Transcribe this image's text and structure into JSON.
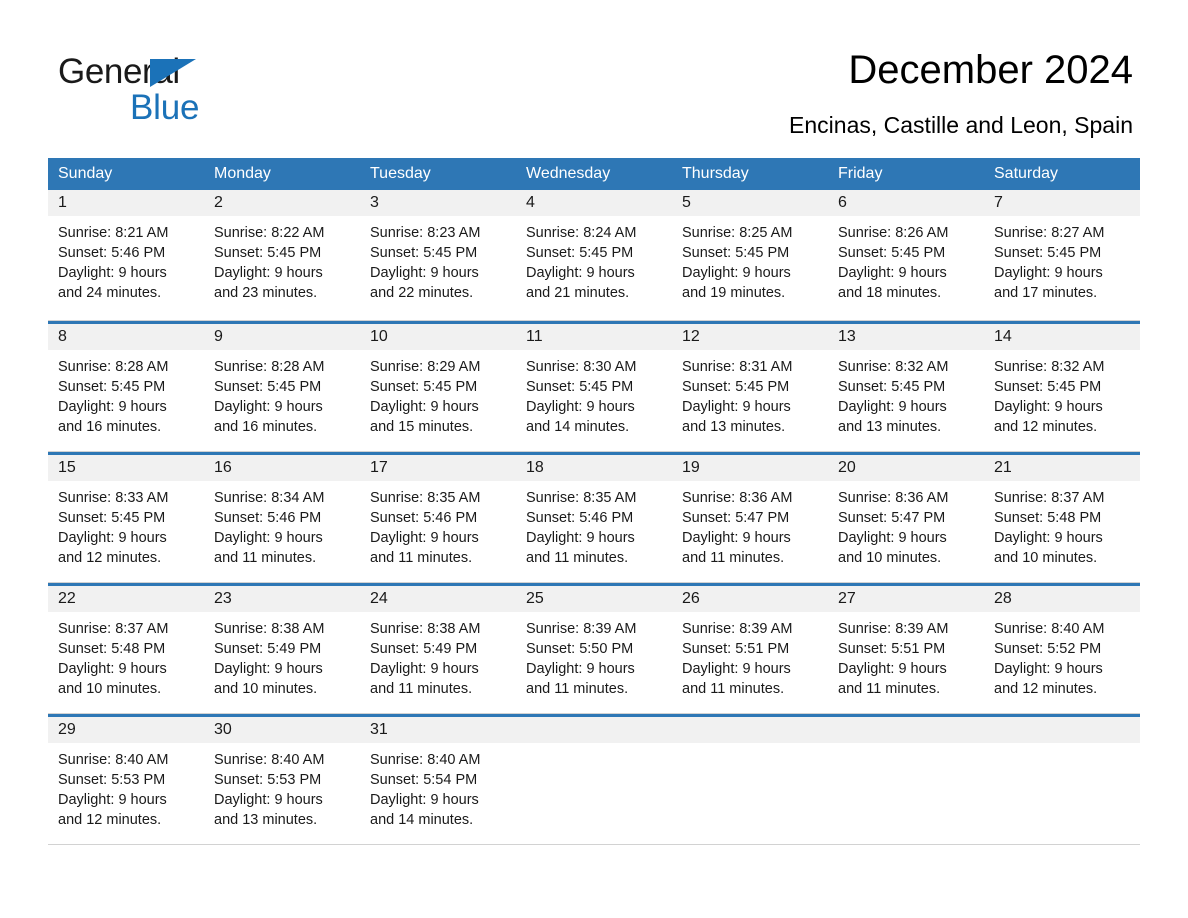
{
  "brand": {
    "name_part1": "General",
    "name_part2": "Blue",
    "accent_color": "#1b72b8"
  },
  "header": {
    "title": "December 2024",
    "subtitle": "Encinas, Castille and Leon, Spain"
  },
  "calendar": {
    "header_bg": "#2e77b5",
    "day_band_bg": "#f1f1f1",
    "weekdays": [
      "Sunday",
      "Monday",
      "Tuesday",
      "Wednesday",
      "Thursday",
      "Friday",
      "Saturday"
    ],
    "weeks": [
      [
        {
          "day": "1",
          "sunrise": "Sunrise: 8:21 AM",
          "sunset": "Sunset: 5:46 PM",
          "daylight_line1": "Daylight: 9 hours",
          "daylight_line2": "and 24 minutes."
        },
        {
          "day": "2",
          "sunrise": "Sunrise: 8:22 AM",
          "sunset": "Sunset: 5:45 PM",
          "daylight_line1": "Daylight: 9 hours",
          "daylight_line2": "and 23 minutes."
        },
        {
          "day": "3",
          "sunrise": "Sunrise: 8:23 AM",
          "sunset": "Sunset: 5:45 PM",
          "daylight_line1": "Daylight: 9 hours",
          "daylight_line2": "and 22 minutes."
        },
        {
          "day": "4",
          "sunrise": "Sunrise: 8:24 AM",
          "sunset": "Sunset: 5:45 PM",
          "daylight_line1": "Daylight: 9 hours",
          "daylight_line2": "and 21 minutes."
        },
        {
          "day": "5",
          "sunrise": "Sunrise: 8:25 AM",
          "sunset": "Sunset: 5:45 PM",
          "daylight_line1": "Daylight: 9 hours",
          "daylight_line2": "and 19 minutes."
        },
        {
          "day": "6",
          "sunrise": "Sunrise: 8:26 AM",
          "sunset": "Sunset: 5:45 PM",
          "daylight_line1": "Daylight: 9 hours",
          "daylight_line2": "and 18 minutes."
        },
        {
          "day": "7",
          "sunrise": "Sunrise: 8:27 AM",
          "sunset": "Sunset: 5:45 PM",
          "daylight_line1": "Daylight: 9 hours",
          "daylight_line2": "and 17 minutes."
        }
      ],
      [
        {
          "day": "8",
          "sunrise": "Sunrise: 8:28 AM",
          "sunset": "Sunset: 5:45 PM",
          "daylight_line1": "Daylight: 9 hours",
          "daylight_line2": "and 16 minutes."
        },
        {
          "day": "9",
          "sunrise": "Sunrise: 8:28 AM",
          "sunset": "Sunset: 5:45 PM",
          "daylight_line1": "Daylight: 9 hours",
          "daylight_line2": "and 16 minutes."
        },
        {
          "day": "10",
          "sunrise": "Sunrise: 8:29 AM",
          "sunset": "Sunset: 5:45 PM",
          "daylight_line1": "Daylight: 9 hours",
          "daylight_line2": "and 15 minutes."
        },
        {
          "day": "11",
          "sunrise": "Sunrise: 8:30 AM",
          "sunset": "Sunset: 5:45 PM",
          "daylight_line1": "Daylight: 9 hours",
          "daylight_line2": "and 14 minutes."
        },
        {
          "day": "12",
          "sunrise": "Sunrise: 8:31 AM",
          "sunset": "Sunset: 5:45 PM",
          "daylight_line1": "Daylight: 9 hours",
          "daylight_line2": "and 13 minutes."
        },
        {
          "day": "13",
          "sunrise": "Sunrise: 8:32 AM",
          "sunset": "Sunset: 5:45 PM",
          "daylight_line1": "Daylight: 9 hours",
          "daylight_line2": "and 13 minutes."
        },
        {
          "day": "14",
          "sunrise": "Sunrise: 8:32 AM",
          "sunset": "Sunset: 5:45 PM",
          "daylight_line1": "Daylight: 9 hours",
          "daylight_line2": "and 12 minutes."
        }
      ],
      [
        {
          "day": "15",
          "sunrise": "Sunrise: 8:33 AM",
          "sunset": "Sunset: 5:45 PM",
          "daylight_line1": "Daylight: 9 hours",
          "daylight_line2": "and 12 minutes."
        },
        {
          "day": "16",
          "sunrise": "Sunrise: 8:34 AM",
          "sunset": "Sunset: 5:46 PM",
          "daylight_line1": "Daylight: 9 hours",
          "daylight_line2": "and 11 minutes."
        },
        {
          "day": "17",
          "sunrise": "Sunrise: 8:35 AM",
          "sunset": "Sunset: 5:46 PM",
          "daylight_line1": "Daylight: 9 hours",
          "daylight_line2": "and 11 minutes."
        },
        {
          "day": "18",
          "sunrise": "Sunrise: 8:35 AM",
          "sunset": "Sunset: 5:46 PM",
          "daylight_line1": "Daylight: 9 hours",
          "daylight_line2": "and 11 minutes."
        },
        {
          "day": "19",
          "sunrise": "Sunrise: 8:36 AM",
          "sunset": "Sunset: 5:47 PM",
          "daylight_line1": "Daylight: 9 hours",
          "daylight_line2": "and 11 minutes."
        },
        {
          "day": "20",
          "sunrise": "Sunrise: 8:36 AM",
          "sunset": "Sunset: 5:47 PM",
          "daylight_line1": "Daylight: 9 hours",
          "daylight_line2": "and 10 minutes."
        },
        {
          "day": "21",
          "sunrise": "Sunrise: 8:37 AM",
          "sunset": "Sunset: 5:48 PM",
          "daylight_line1": "Daylight: 9 hours",
          "daylight_line2": "and 10 minutes."
        }
      ],
      [
        {
          "day": "22",
          "sunrise": "Sunrise: 8:37 AM",
          "sunset": "Sunset: 5:48 PM",
          "daylight_line1": "Daylight: 9 hours",
          "daylight_line2": "and 10 minutes."
        },
        {
          "day": "23",
          "sunrise": "Sunrise: 8:38 AM",
          "sunset": "Sunset: 5:49 PM",
          "daylight_line1": "Daylight: 9 hours",
          "daylight_line2": "and 10 minutes."
        },
        {
          "day": "24",
          "sunrise": "Sunrise: 8:38 AM",
          "sunset": "Sunset: 5:49 PM",
          "daylight_line1": "Daylight: 9 hours",
          "daylight_line2": "and 11 minutes."
        },
        {
          "day": "25",
          "sunrise": "Sunrise: 8:39 AM",
          "sunset": "Sunset: 5:50 PM",
          "daylight_line1": "Daylight: 9 hours",
          "daylight_line2": "and 11 minutes."
        },
        {
          "day": "26",
          "sunrise": "Sunrise: 8:39 AM",
          "sunset": "Sunset: 5:51 PM",
          "daylight_line1": "Daylight: 9 hours",
          "daylight_line2": "and 11 minutes."
        },
        {
          "day": "27",
          "sunrise": "Sunrise: 8:39 AM",
          "sunset": "Sunset: 5:51 PM",
          "daylight_line1": "Daylight: 9 hours",
          "daylight_line2": "and 11 minutes."
        },
        {
          "day": "28",
          "sunrise": "Sunrise: 8:40 AM",
          "sunset": "Sunset: 5:52 PM",
          "daylight_line1": "Daylight: 9 hours",
          "daylight_line2": "and 12 minutes."
        }
      ],
      [
        {
          "day": "29",
          "sunrise": "Sunrise: 8:40 AM",
          "sunset": "Sunset: 5:53 PM",
          "daylight_line1": "Daylight: 9 hours",
          "daylight_line2": "and 12 minutes."
        },
        {
          "day": "30",
          "sunrise": "Sunrise: 8:40 AM",
          "sunset": "Sunset: 5:53 PM",
          "daylight_line1": "Daylight: 9 hours",
          "daylight_line2": "and 13 minutes."
        },
        {
          "day": "31",
          "sunrise": "Sunrise: 8:40 AM",
          "sunset": "Sunset: 5:54 PM",
          "daylight_line1": "Daylight: 9 hours",
          "daylight_line2": "and 14 minutes."
        },
        {
          "day": "",
          "sunrise": "",
          "sunset": "",
          "daylight_line1": "",
          "daylight_line2": ""
        },
        {
          "day": "",
          "sunrise": "",
          "sunset": "",
          "daylight_line1": "",
          "daylight_line2": ""
        },
        {
          "day": "",
          "sunrise": "",
          "sunset": "",
          "daylight_line1": "",
          "daylight_line2": ""
        },
        {
          "day": "",
          "sunrise": "",
          "sunset": "",
          "daylight_line1": "",
          "daylight_line2": ""
        }
      ]
    ]
  }
}
